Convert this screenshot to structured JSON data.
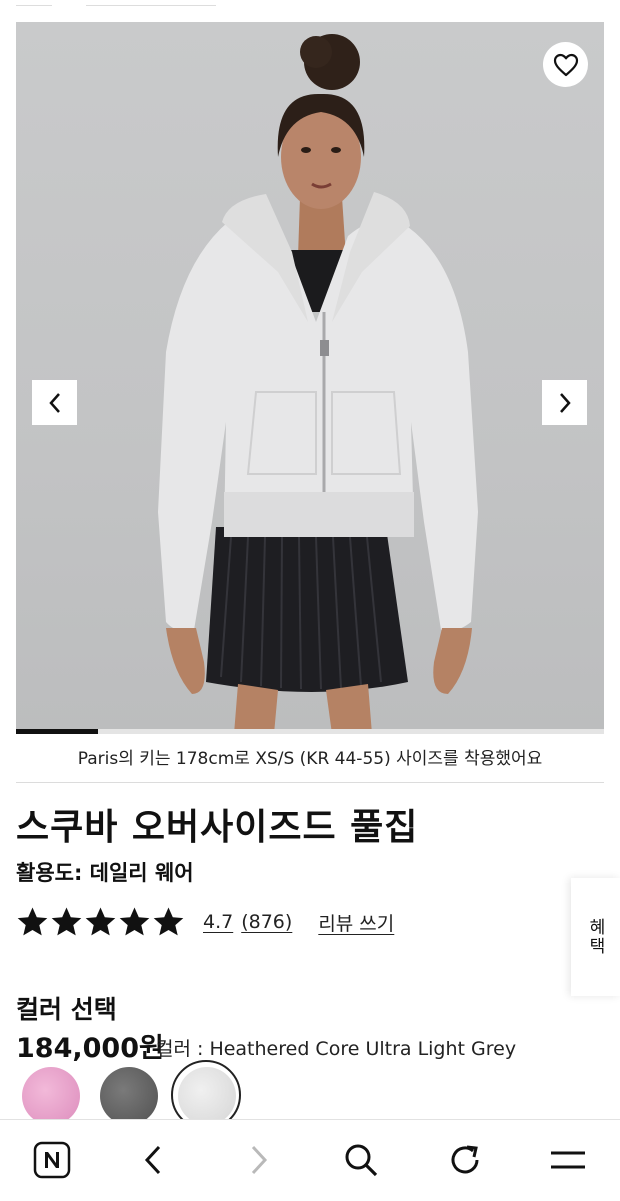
{
  "gallery": {
    "model_note": "Paris의 키는 178cm로 XS/S (KR 44-55) 사이즈를 착용했어요",
    "progress_fraction": 0.14,
    "icons": {
      "favorite": "heart-outline-icon",
      "prev": "chevron-left-icon",
      "next": "chevron-right-icon"
    }
  },
  "product": {
    "title": "스쿠바 오버사이즈드 풀집",
    "usage": "활용도: 데일리 웨어",
    "rating": {
      "stars": 5,
      "value": "4.7",
      "count": "(876)",
      "write_review": "리뷰 쓰기"
    },
    "side_tab": "혜택",
    "color_heading": "컬러 선택",
    "price": "184,000원",
    "color_label": "컬러 : Heathered Core Ultra Light Grey",
    "swatches": [
      {
        "name": "pink",
        "color": "#e9a6cf",
        "selected": false
      },
      {
        "name": "dark-grey",
        "color": "#646464",
        "selected": false
      },
      {
        "name": "Heathered Core Ultra Light Grey",
        "color": "#dedede",
        "selected": true
      }
    ]
  },
  "browser_bar": {
    "buttons": [
      "naver-home-icon",
      "back-icon",
      "forward-icon",
      "search-icon",
      "refresh-icon",
      "menu-icon"
    ]
  },
  "colors": {
    "accent": "#111111",
    "background": "#ffffff",
    "photo_bg": "#c4c5c6"
  }
}
